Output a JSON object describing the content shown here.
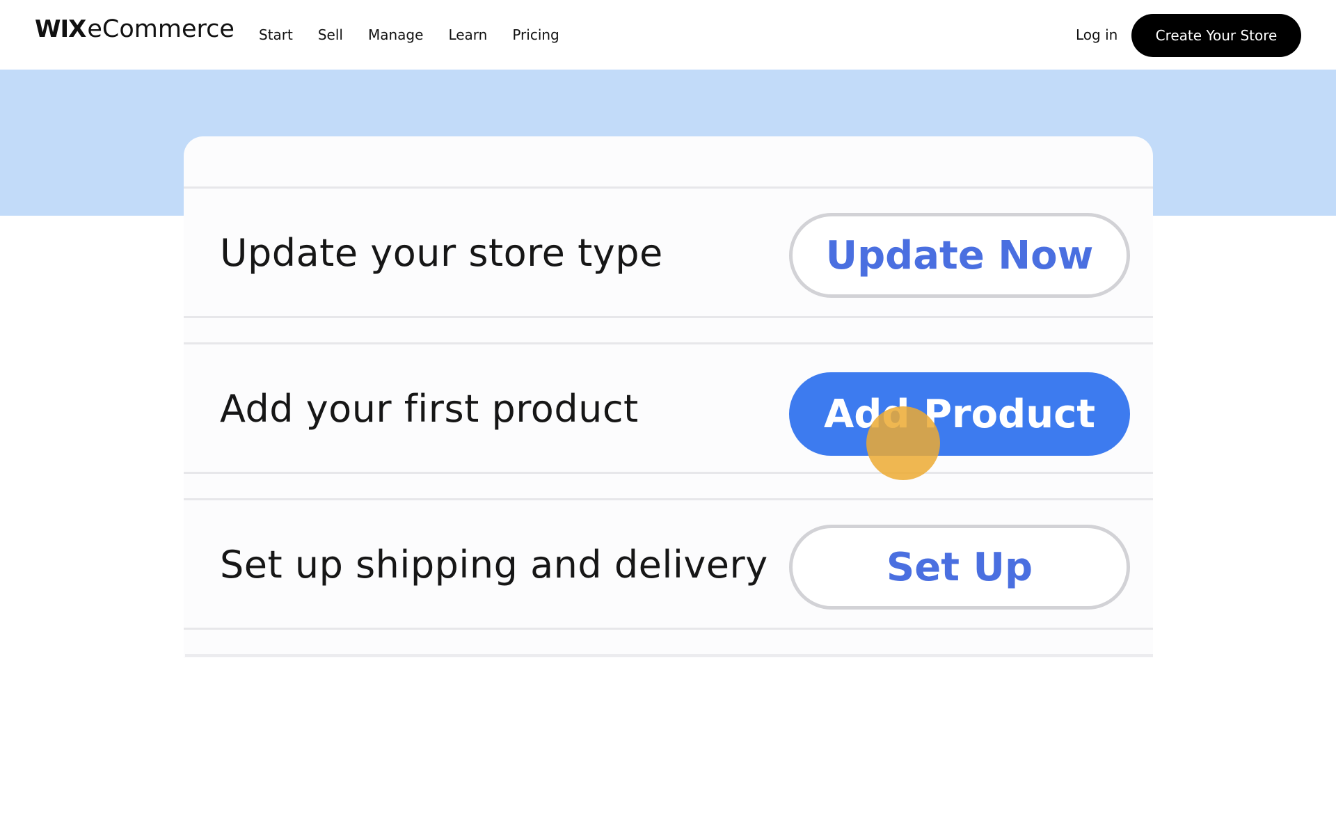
{
  "header": {
    "logo_wix": "WIX",
    "logo_product": "eCommerce",
    "nav": [
      "Start",
      "Sell",
      "Manage",
      "Learn",
      "Pricing"
    ],
    "login_label": "Log in",
    "cta_label": "Create Your Store"
  },
  "checklist": {
    "items": [
      {
        "label": "Update your store type",
        "button": "Update Now",
        "style": "outline"
      },
      {
        "label": "Add your first product",
        "button": "Add Product",
        "style": "solid"
      },
      {
        "label": "Set up shipping and delivery",
        "button": "Set Up",
        "style": "outline"
      }
    ]
  },
  "colors": {
    "band": "#c2dbf9",
    "primary_button": "#3d7bef",
    "outline_button_text": "#4a6fe0",
    "cursor_highlight": "#ecaa32",
    "cta_background": "#000000"
  },
  "icons": {
    "cursor": "click-indicator-icon"
  }
}
